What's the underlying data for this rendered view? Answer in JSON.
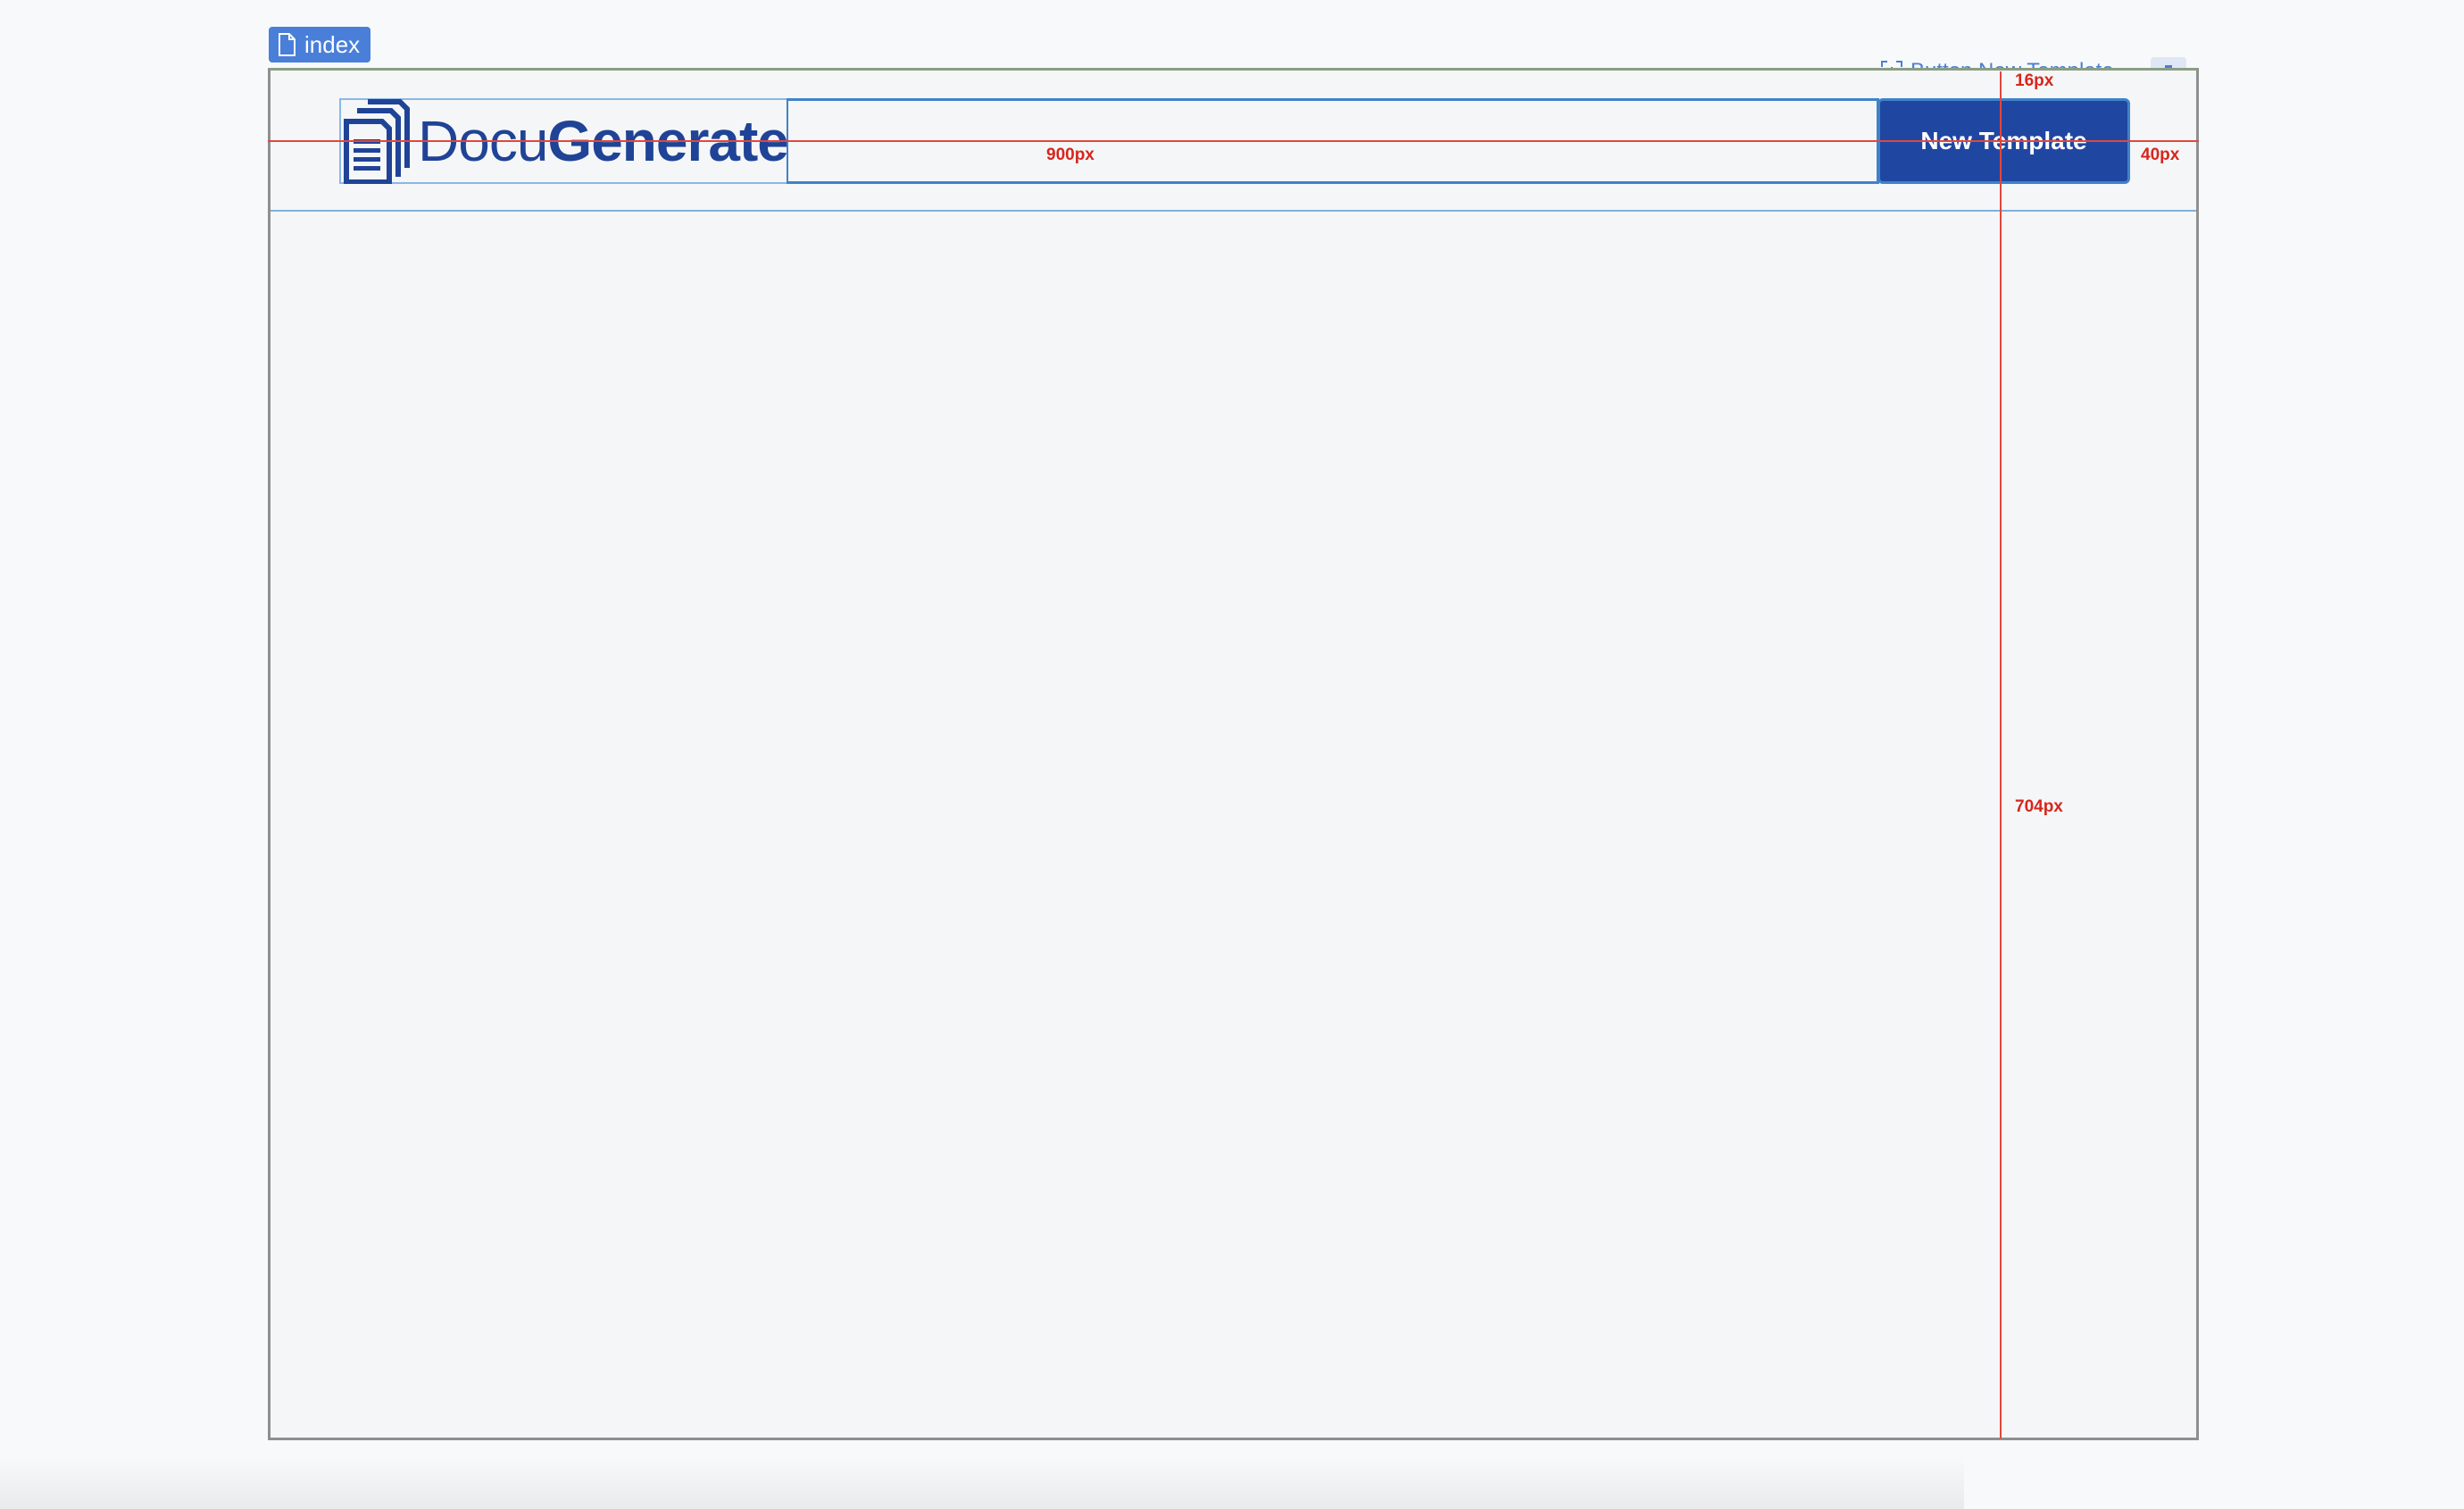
{
  "page_tab": {
    "label": "index",
    "icon": "document-icon"
  },
  "header": {
    "logo": {
      "icon": "documents-stack-icon",
      "text_light": "Docu",
      "text_bold": "Generate"
    },
    "new_template_button": "New Template"
  },
  "inspector": {
    "component_label": "Button New Template",
    "icon": "component-select-icon",
    "hierarchy_icon": "hierarchy-icon"
  },
  "measurements": {
    "width_label": "900px",
    "top_label": "16px",
    "right_label": "40px",
    "height_label": "704px"
  },
  "colors": {
    "brand": "#1f4396",
    "button_bg": "#1f47a2",
    "selection": "#3f82c9",
    "guide": "#e0473c",
    "tab": "#4a7fd9"
  }
}
